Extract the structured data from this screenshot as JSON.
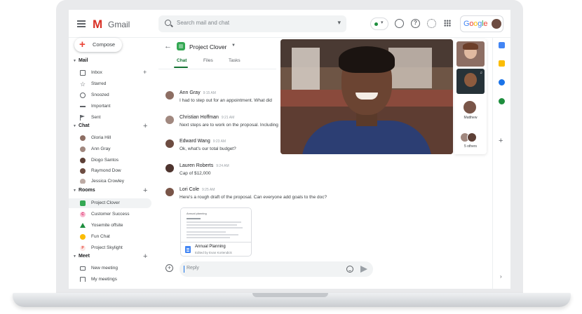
{
  "app": {
    "name": "Gmail",
    "logo_letter": "M",
    "brand_word": "Google"
  },
  "search": {
    "placeholder": "Search mail and chat"
  },
  "compose": {
    "label": "Compose"
  },
  "sidebar": {
    "mail_header": "Mail",
    "mail_items": [
      {
        "label": "Inbox",
        "icon": "inbox-icon"
      },
      {
        "label": "Starred",
        "icon": "star-icon"
      },
      {
        "label": "Snoozed",
        "icon": "clock-icon"
      },
      {
        "label": "Important",
        "icon": "label-icon"
      },
      {
        "label": "Sent",
        "icon": "send-icon"
      }
    ],
    "chat_header": "Chat",
    "chat_items": [
      {
        "label": "Gloria Hill",
        "color": "#8d6e63"
      },
      {
        "label": "Ann Gray",
        "color": "#a1887f"
      },
      {
        "label": "Diogo Santos",
        "color": "#5d4037"
      },
      {
        "label": "Raymond Dow",
        "color": "#6d4c41"
      },
      {
        "label": "Jessica Crowley",
        "color": "#bcaaa4"
      }
    ],
    "rooms_header": "Rooms",
    "rooms_items": [
      {
        "label": "Project Clover",
        "color": "#34a853",
        "letter": ""
      },
      {
        "label": "Customer Success",
        "color": "#f06292",
        "letter": "C"
      },
      {
        "label": "Yosemite offsite",
        "color": "#1e8e3e",
        "letter": ""
      },
      {
        "label": "Fun Chat",
        "color": "#fbbc04",
        "letter": ""
      },
      {
        "label": "Project Skylight",
        "color": "#ea4335",
        "letter": "P"
      }
    ],
    "meet_header": "Meet",
    "meet_items": [
      {
        "label": "New meeting"
      },
      {
        "label": "My meetings"
      }
    ]
  },
  "room": {
    "title": "Project Clover",
    "tabs": [
      "Chat",
      "Files",
      "Tasks"
    ]
  },
  "messages": [
    {
      "name": "Ann Gray",
      "time": "9:15 AM",
      "text": "I had to step out for an appointment. What did",
      "color": "#8d6e63"
    },
    {
      "name": "Christian Hoffman",
      "time": "9:21 AM",
      "text": "Next steps are to work on the proposal. Including",
      "color": "#a1887f"
    },
    {
      "name": "Edward Wang",
      "time": "9:23 AM",
      "text": "Ok, what's our total budget?",
      "color": "#6d4c41"
    },
    {
      "name": "Lauren Roberts",
      "time": "9:24 AM",
      "text": "Cap of $12,000",
      "color": "#4e342e"
    },
    {
      "name": "Lori Cole",
      "time": "9:25 AM",
      "text": "Here's a rough draft of the proposal. Can everyone add goals to the doc?",
      "color": "#795548"
    }
  ],
  "attachment": {
    "name": "Annual Planning",
    "subtitle": "Edited by Evan Kortendick",
    "preview_title": "Annual planning"
  },
  "composer": {
    "placeholder": "Reply"
  },
  "call": {
    "participants": [
      {
        "label": ""
      },
      {
        "label": ""
      },
      {
        "label": "Matthew"
      },
      {
        "label": "5 others"
      }
    ]
  },
  "colors": {
    "accent": "#137333",
    "gmail_red": "#d93025"
  }
}
